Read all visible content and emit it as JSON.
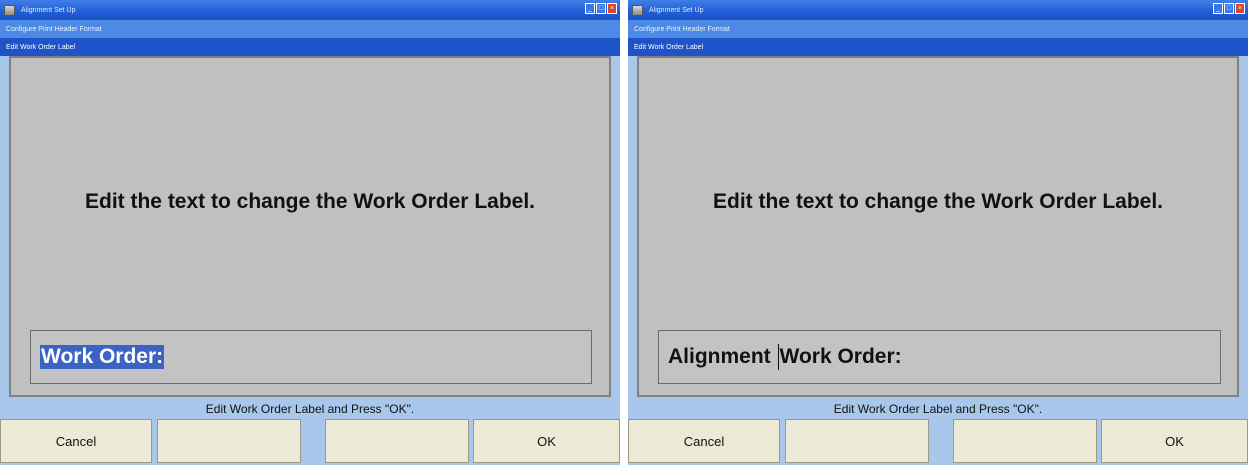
{
  "left": {
    "window_title": "Alignment Set Up",
    "menu_title": "Configure Print Header Format",
    "dialog_title": "Edit Work Order Label",
    "instruction": "Edit the text to change the Work Order Label.",
    "field_text_selected": "Work Order:",
    "status": "Edit Work Order Label and Press \"OK\".",
    "buttons": [
      "Cancel",
      "",
      "",
      "OK"
    ]
  },
  "right": {
    "window_title": "Alignment Set Up",
    "menu_title": "Configure Print Header Format",
    "dialog_title": "Edit Work Order Label",
    "instruction": "Edit the text to change the Work Order Label.",
    "field_text_before_caret": "Alignment ",
    "field_text_after_caret": "Work Order:",
    "status": "Edit Work Order Label and Press \"OK\".",
    "buttons": [
      "Cancel",
      "",
      "",
      "OK"
    ]
  },
  "window_controls": {
    "minimize": "_",
    "maximize": "□",
    "close": "×"
  },
  "colors": {
    "titlebar": "#2160d8",
    "dialog_bar": "#1f54c8",
    "content_bg": "#c0c0c0",
    "selection": "#3b63c4",
    "button_bg": "#ece9d6",
    "status_bg": "#a9c7ea"
  }
}
